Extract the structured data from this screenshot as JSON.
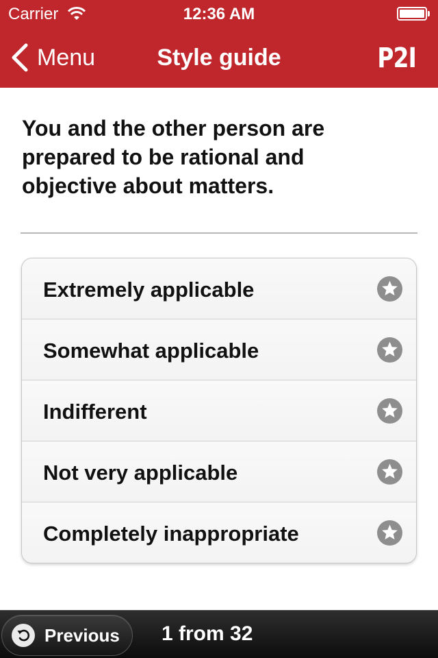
{
  "status_bar": {
    "carrier": "Carrier",
    "time": "12:36 AM"
  },
  "nav": {
    "back_label": "Menu",
    "title": "Style guide",
    "logo": "P2I"
  },
  "question": {
    "text": "You and the other person are prepared to be rational and objective about matters."
  },
  "options": [
    {
      "label": "Extremely applicable"
    },
    {
      "label": "Somewhat applicable"
    },
    {
      "label": "Indifferent"
    },
    {
      "label": "Not very applicable"
    },
    {
      "label": "Completely inappropriate"
    }
  ],
  "footer": {
    "previous_label": "Previous",
    "counter": "1 from 32"
  },
  "colors": {
    "brand_red": "#c0272d",
    "star_gray": "#8e8e8e"
  }
}
